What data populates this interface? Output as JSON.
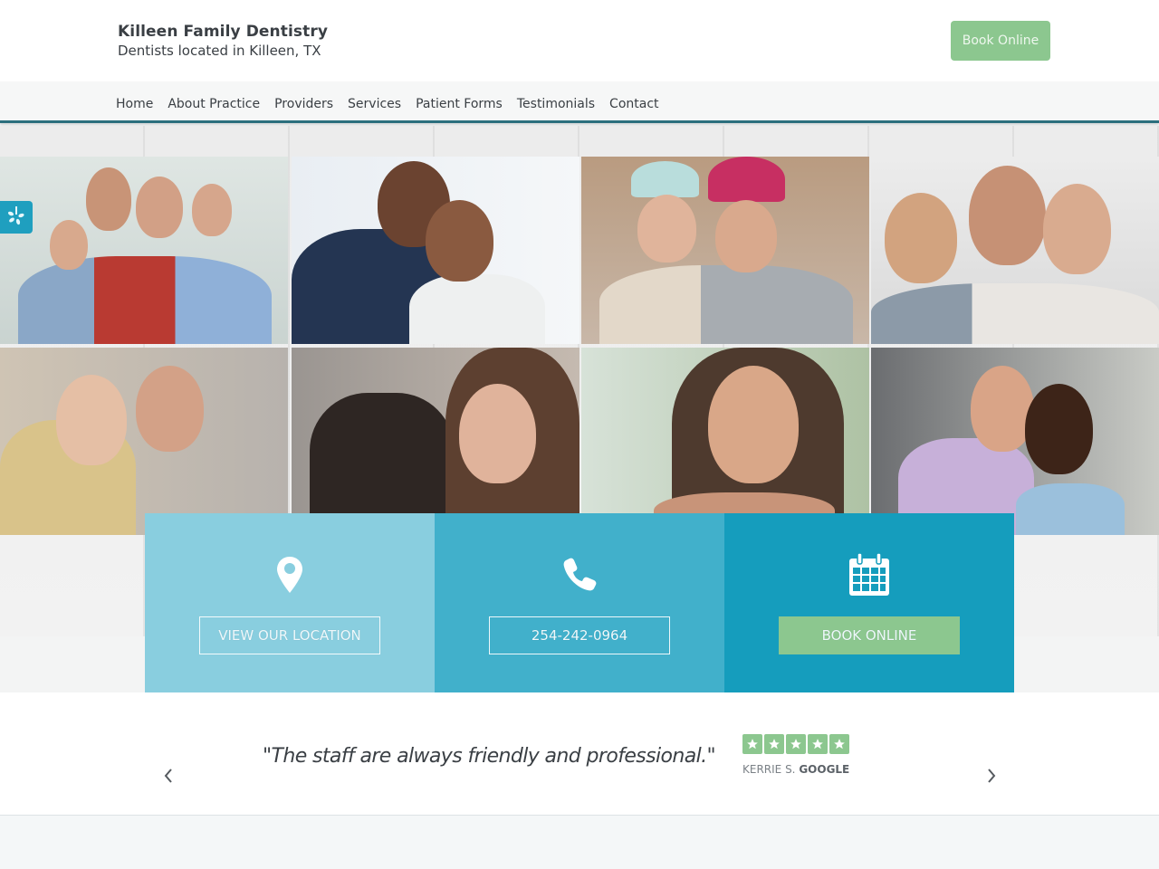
{
  "header": {
    "title": "Killeen Family Dentistry",
    "tagline": "Dentists located in Killeen, TX",
    "book_button": "Book Online"
  },
  "nav": {
    "items": [
      "Home",
      "About Practice",
      "Providers",
      "Services",
      "Patient Forms",
      "Testimonials",
      "Contact"
    ]
  },
  "hero": {
    "photos": [
      {
        "name": "family-photo",
        "icon": "photo"
      },
      {
        "name": "senior-couple-photo",
        "icon": "photo"
      },
      {
        "name": "friends-winter-hats-photo",
        "icon": "photo"
      },
      {
        "name": "father-son-mother-photo",
        "icon": "photo"
      },
      {
        "name": "two-women-photo",
        "icon": "photo"
      },
      {
        "name": "mother-daughter-photo",
        "icon": "photo"
      },
      {
        "name": "smiling-woman-photo",
        "icon": "photo"
      },
      {
        "name": "couple-festival-photo",
        "icon": "photo"
      }
    ],
    "yelp_icon": "yelp-icon"
  },
  "cta": {
    "location": {
      "icon": "map-pin-icon",
      "label": "VIEW OUR LOCATION"
    },
    "phone": {
      "icon": "phone-icon",
      "label": "254-242-0964"
    },
    "book": {
      "icon": "calendar-icon",
      "label": "BOOK ONLINE"
    }
  },
  "testimonial": {
    "quote": "\"The staff are always friendly and professional.\"",
    "rating": 5,
    "rating_max": 5,
    "reviewer": "KERRIE S.",
    "source": "GOOGLE"
  },
  "colors": {
    "accent_green": "#8cc78f",
    "cta_light": "#89cedf",
    "cta_mid": "#41b0cb",
    "cta_dark": "#159dbd",
    "nav_border": "#2b6f7d"
  }
}
